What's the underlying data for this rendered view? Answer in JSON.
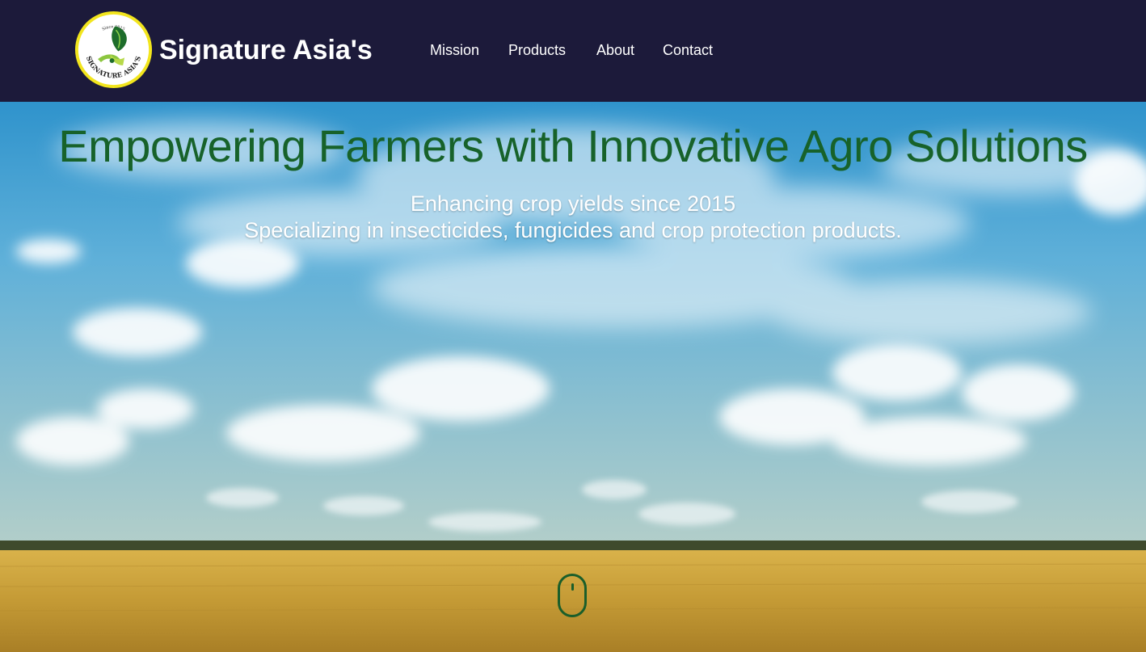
{
  "header": {
    "brand": "Signature Asia's",
    "logo": {
      "top_text": "Since 2015",
      "ring_text": "SIGNATURE ASIA'S",
      "icon": "leaf-icon"
    },
    "nav": [
      {
        "label": "Mission"
      },
      {
        "label": "Products"
      },
      {
        "label": "About"
      },
      {
        "label": "Contact"
      }
    ]
  },
  "hero": {
    "title": "Empowering Farmers with Innovative Agro Solutions",
    "subtitle_line1": "Enhancing crop yields since 2015",
    "subtitle_line2": "Specializing in insecticides, fungicides and crop protection products.",
    "background": "sky-and-wheat-field-photo",
    "scroll_indicator": "mouse-scroll-icon"
  },
  "colors": {
    "header_bg": "#1c1a3a",
    "title_green": "#17622a",
    "logo_ring": "#f2e51d",
    "sky": "#3d9fd2",
    "field": "#c9a13b"
  }
}
